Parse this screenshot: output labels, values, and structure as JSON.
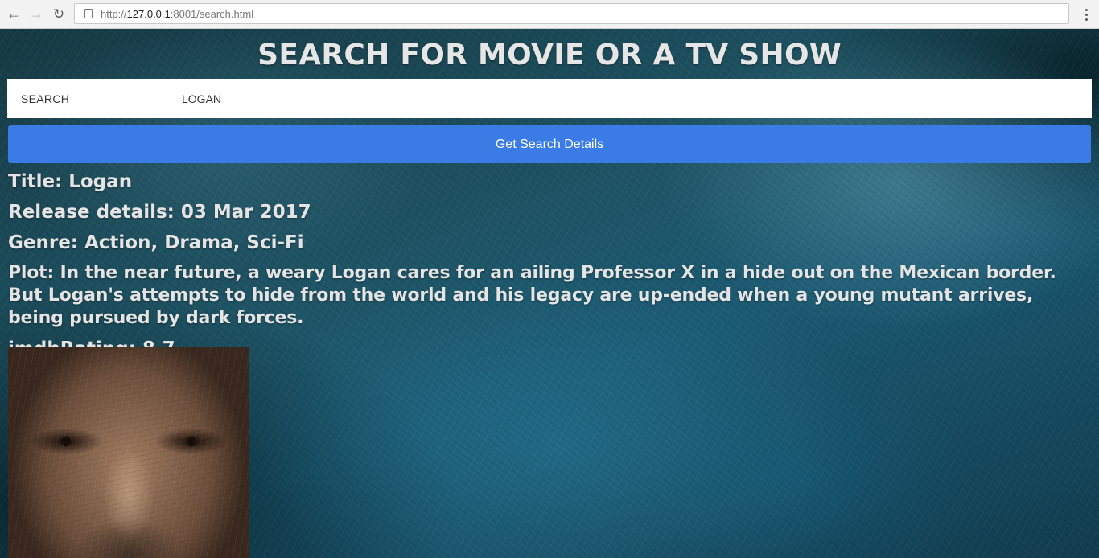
{
  "browser": {
    "url_prefix": "http://",
    "url_host": "127.0.0.1",
    "url_rest": ":8001/search.html",
    "back_icon": "arrow-left-icon",
    "forward_icon": "arrow-right-icon",
    "reload_icon": "reload-icon",
    "menu_icon": "kebab-menu-icon"
  },
  "page": {
    "heading": "SEARCH FOR MOVIE OR A TV SHOW",
    "search": {
      "label": "SEARCH",
      "value": "LOGAN"
    },
    "button_label": "Get Search Details",
    "result": {
      "title": "Title: Logan",
      "release": "Release details: 03 Mar 2017",
      "genre": "Genre: Action, Drama, Sci-Fi",
      "plot": "Plot: In the near future, a weary Logan cares for an ailing Professor X in a hide out on the Mexican border. But Logan's attempts to hide from the world and his legacy are up-ended when a young mutant arrives, being pursued by dark forces.",
      "rating": "imdbRating: 8.7"
    },
    "colors": {
      "button": "#3a7be6",
      "heading_text": "#e6e6e6",
      "background": "#1f5566"
    }
  }
}
